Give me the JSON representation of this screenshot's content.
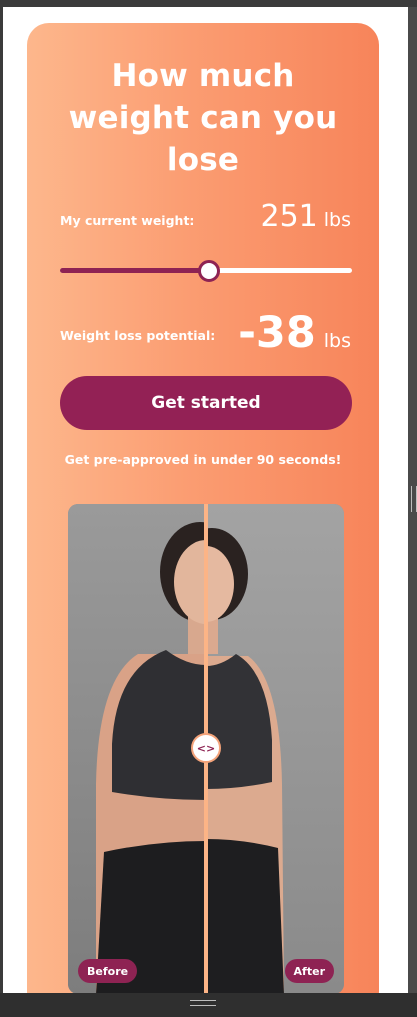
{
  "hero": {
    "title_line1": "How much",
    "title_line2": "weight can you",
    "title_line3": "lose"
  },
  "current_weight": {
    "label": "My current weight:",
    "value": "251",
    "unit": "lbs"
  },
  "slider": {
    "fraction": 0.505
  },
  "weight_loss": {
    "label": "Weight loss potential:",
    "value": "-38",
    "unit": "lbs"
  },
  "cta": {
    "label": "Get started"
  },
  "subtext": "Get pre-approved in under 90 seconds!",
  "comparison": {
    "handle_glyph": "<>",
    "before_label": "Before",
    "after_label": "After",
    "divider_fraction": 0.5
  },
  "colors": {
    "accent": "#932155",
    "gradient_start": "#fdb78c",
    "gradient_end": "#f7845a"
  },
  "icons": {
    "handle": "chevrons-left-right-icon"
  }
}
